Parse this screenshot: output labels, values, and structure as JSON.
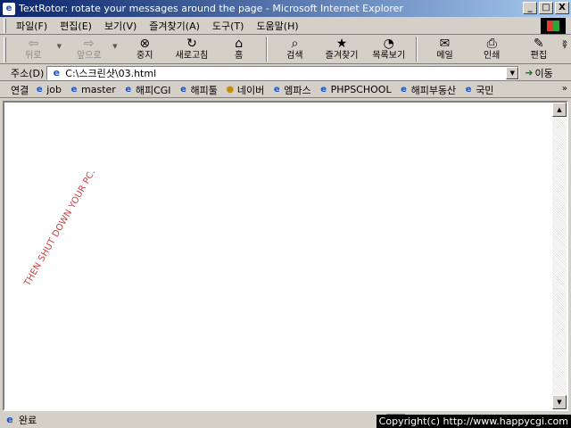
{
  "window": {
    "title": "TextRotor: rotate your messages around the page - Microsoft Internet Explorer",
    "minimize_glyph": "_",
    "maximize_glyph": "□",
    "close_glyph": "X"
  },
  "menu": {
    "items": [
      "파일(F)",
      "편집(E)",
      "보기(V)",
      "즐겨찾기(A)",
      "도구(T)",
      "도움말(H)"
    ]
  },
  "toolbar": {
    "back": "뒤로",
    "forward": "앞으로",
    "stop": "중지",
    "refresh": "새로고침",
    "home": "홈",
    "search": "검색",
    "favorites": "즐겨찾기",
    "history": "목록보기",
    "mail": "메일",
    "print": "인쇄",
    "edit": "편집",
    "more": "»"
  },
  "address": {
    "label": "주소(D)",
    "value": "C:\\스크린샷\\03.html",
    "go": "이동"
  },
  "links": {
    "label": "연결",
    "items": [
      "job",
      "master",
      "해피CGI",
      "해피툴",
      "네이버",
      "엠파스",
      "PHPSCHOOL",
      "해피부동산",
      "국민"
    ],
    "more": "»"
  },
  "content": {
    "rotated_message": "THEN SHUT DOWN YOUR PC."
  },
  "status": {
    "text": "완료",
    "copyright": "Copyright(c) http://www.happycgi.com"
  },
  "colors": {
    "title_gradient_start": "#0a246a",
    "title_gradient_end": "#a6caf0",
    "chrome": "#d4d0c8",
    "rotated_text": "#cc3b3b"
  }
}
